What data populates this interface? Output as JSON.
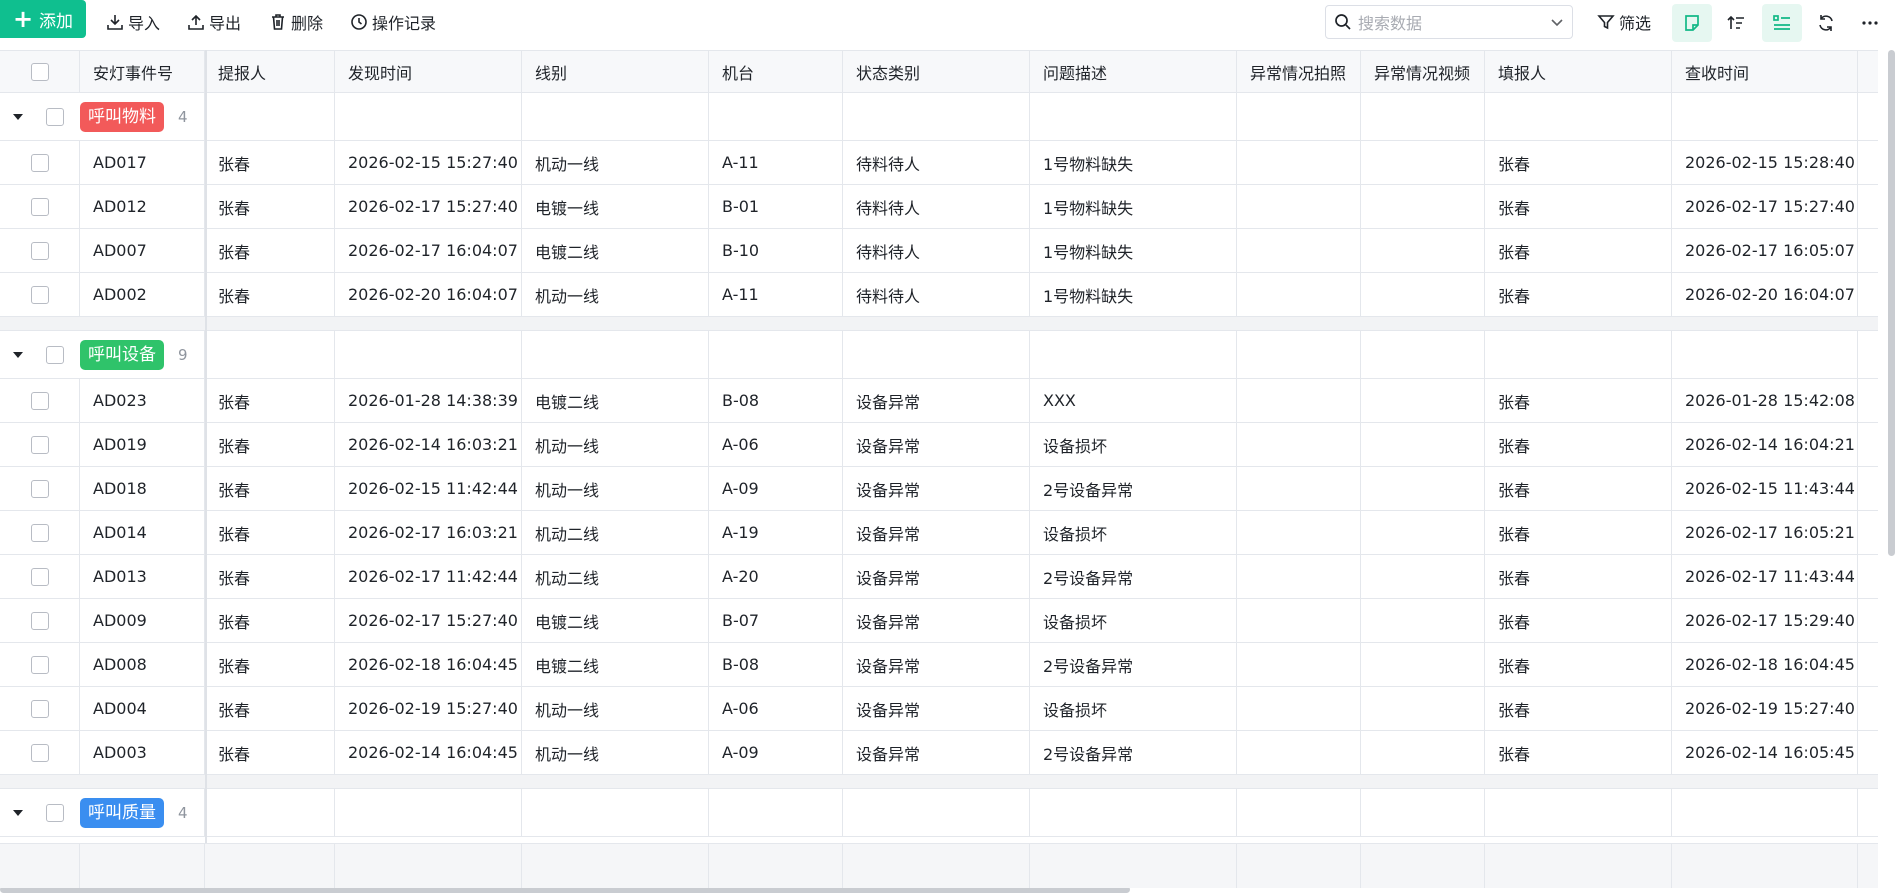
{
  "toolbar": {
    "add_label": "添加",
    "import_label": "导入",
    "export_label": "导出",
    "delete_label": "删除",
    "log_label": "操作记录",
    "search_placeholder": "搜索数据",
    "filter_label": "筛选"
  },
  "columns": [
    "安灯事件号",
    "提报人",
    "发现时间",
    "线别",
    "机台",
    "状态类别",
    "问题描述",
    "异常情况拍照",
    "异常情况视频",
    "填报人",
    "查收时间"
  ],
  "groups": [
    {
      "label": "呼叫物料",
      "count": "4",
      "color": "#f25a5a",
      "rows": [
        [
          "AD017",
          "张春",
          "2026-02-15 15:27:40",
          "机动一线",
          "A-11",
          "待料待人",
          "1号物料缺失",
          "",
          "",
          "张春",
          "2026-02-15 15:28:40"
        ],
        [
          "AD012",
          "张春",
          "2026-02-17 15:27:40",
          "电镀一线",
          "B-01",
          "待料待人",
          "1号物料缺失",
          "",
          "",
          "张春",
          "2026-02-17 15:27:40"
        ],
        [
          "AD007",
          "张春",
          "2026-02-17 16:04:07",
          "电镀二线",
          "B-10",
          "待料待人",
          "1号物料缺失",
          "",
          "",
          "张春",
          "2026-02-17 16:05:07"
        ],
        [
          "AD002",
          "张春",
          "2026-02-20 16:04:07",
          "机动一线",
          "A-11",
          "待料待人",
          "1号物料缺失",
          "",
          "",
          "张春",
          "2026-02-20 16:04:07"
        ]
      ]
    },
    {
      "label": "呼叫设备",
      "count": "9",
      "color": "#2fc36a",
      "rows": [
        [
          "AD023",
          "张春",
          "2026-01-28 14:38:39",
          "电镀二线",
          "B-08",
          "设备异常",
          "XXX",
          "",
          "",
          "张春",
          "2026-01-28 15:42:08"
        ],
        [
          "AD019",
          "张春",
          "2026-02-14 16:03:21",
          "机动一线",
          "A-06",
          "设备异常",
          "设备损坏",
          "",
          "",
          "张春",
          "2026-02-14 16:04:21"
        ],
        [
          "AD018",
          "张春",
          "2026-02-15 11:42:44",
          "机动一线",
          "A-09",
          "设备异常",
          "2号设备异常",
          "",
          "",
          "张春",
          "2026-02-15 11:43:44"
        ],
        [
          "AD014",
          "张春",
          "2026-02-17 16:03:21",
          "机动二线",
          "A-19",
          "设备异常",
          "设备损坏",
          "",
          "",
          "张春",
          "2026-02-17 16:05:21"
        ],
        [
          "AD013",
          "张春",
          "2026-02-17 11:42:44",
          "机动二线",
          "A-20",
          "设备异常",
          "2号设备异常",
          "",
          "",
          "张春",
          "2026-02-17 11:43:44"
        ],
        [
          "AD009",
          "张春",
          "2026-02-17 15:27:40",
          "电镀二线",
          "B-07",
          "设备异常",
          "设备损坏",
          "",
          "",
          "张春",
          "2026-02-17 15:29:40"
        ],
        [
          "AD008",
          "张春",
          "2026-02-18 16:04:45",
          "电镀二线",
          "B-08",
          "设备异常",
          "2号设备异常",
          "",
          "",
          "张春",
          "2026-02-18 16:04:45"
        ],
        [
          "AD004",
          "张春",
          "2026-02-19 15:27:40",
          "机动一线",
          "A-06",
          "设备异常",
          "设备损坏",
          "",
          "",
          "张春",
          "2026-02-19 15:27:40"
        ],
        [
          "AD003",
          "张春",
          "2026-02-14 16:04:45",
          "机动一线",
          "A-09",
          "设备异常",
          "2号设备异常",
          "",
          "",
          "张春",
          "2026-02-14 16:05:45"
        ]
      ]
    },
    {
      "label": "呼叫质量",
      "count": "4",
      "color": "#3a8ef0",
      "rows": []
    }
  ]
}
